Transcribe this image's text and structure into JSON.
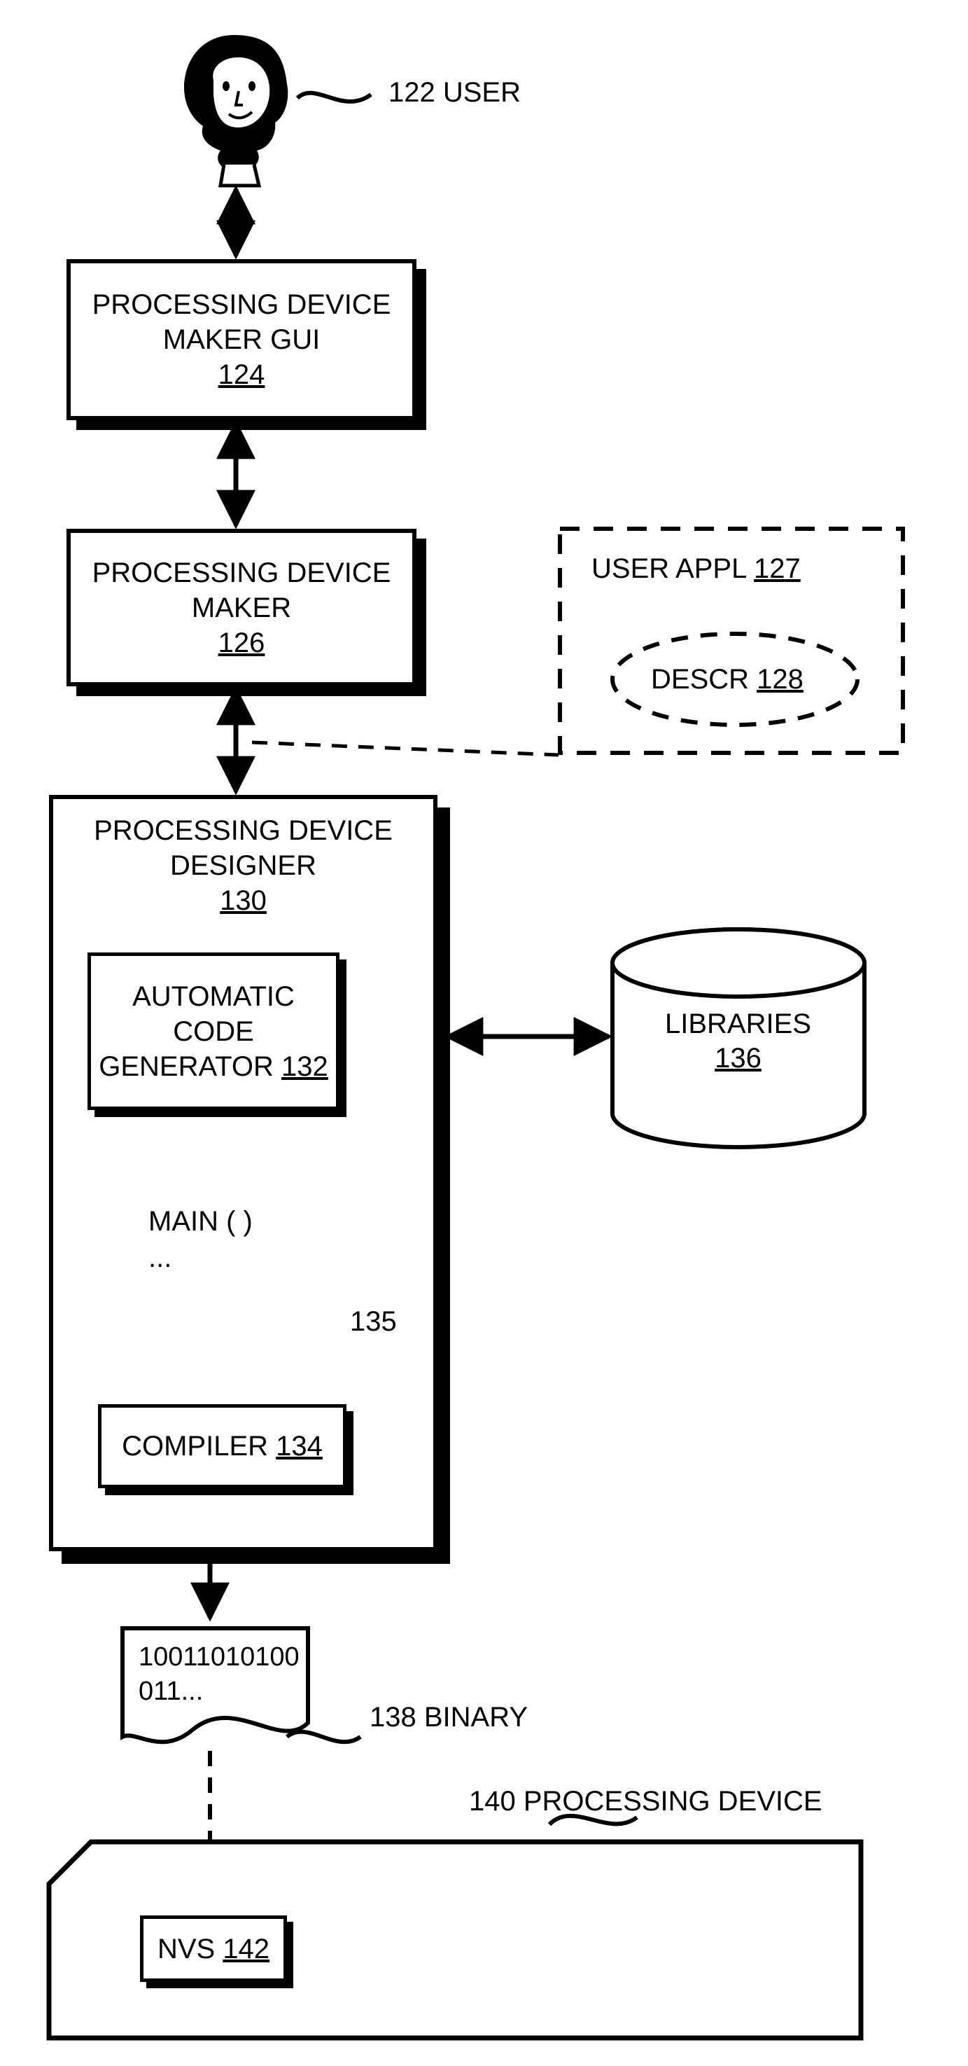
{
  "user": {
    "label": "122 USER"
  },
  "maker_gui": {
    "line1": "PROCESSING DEVICE",
    "line2": "MAKER GUI",
    "ref": "124"
  },
  "maker": {
    "line1": "PROCESSING DEVICE",
    "line2": "MAKER",
    "ref": "126"
  },
  "user_appl": {
    "label": "USER APPL",
    "ref": "127"
  },
  "descr": {
    "label": "DESCR",
    "ref": "128"
  },
  "designer": {
    "line1": "PROCESSING DEVICE",
    "line2": "DESIGNER",
    "ref": "130"
  },
  "code_gen": {
    "line1": "AUTOMATIC",
    "line2": "CODE",
    "line3": "GENERATOR",
    "ref": "132"
  },
  "main_doc": {
    "line1": "MAIN ( )",
    "line2": "...",
    "ref": "135"
  },
  "compiler": {
    "label": "COMPILER",
    "ref": "134"
  },
  "libraries": {
    "label": "LIBRARIES",
    "ref": "136"
  },
  "binary": {
    "line1": "10011010100",
    "line2": "011...",
    "label": "138 BINARY"
  },
  "device": {
    "label": "140 PROCESSING DEVICE"
  },
  "nvs": {
    "label": "NVS",
    "ref": "142"
  }
}
